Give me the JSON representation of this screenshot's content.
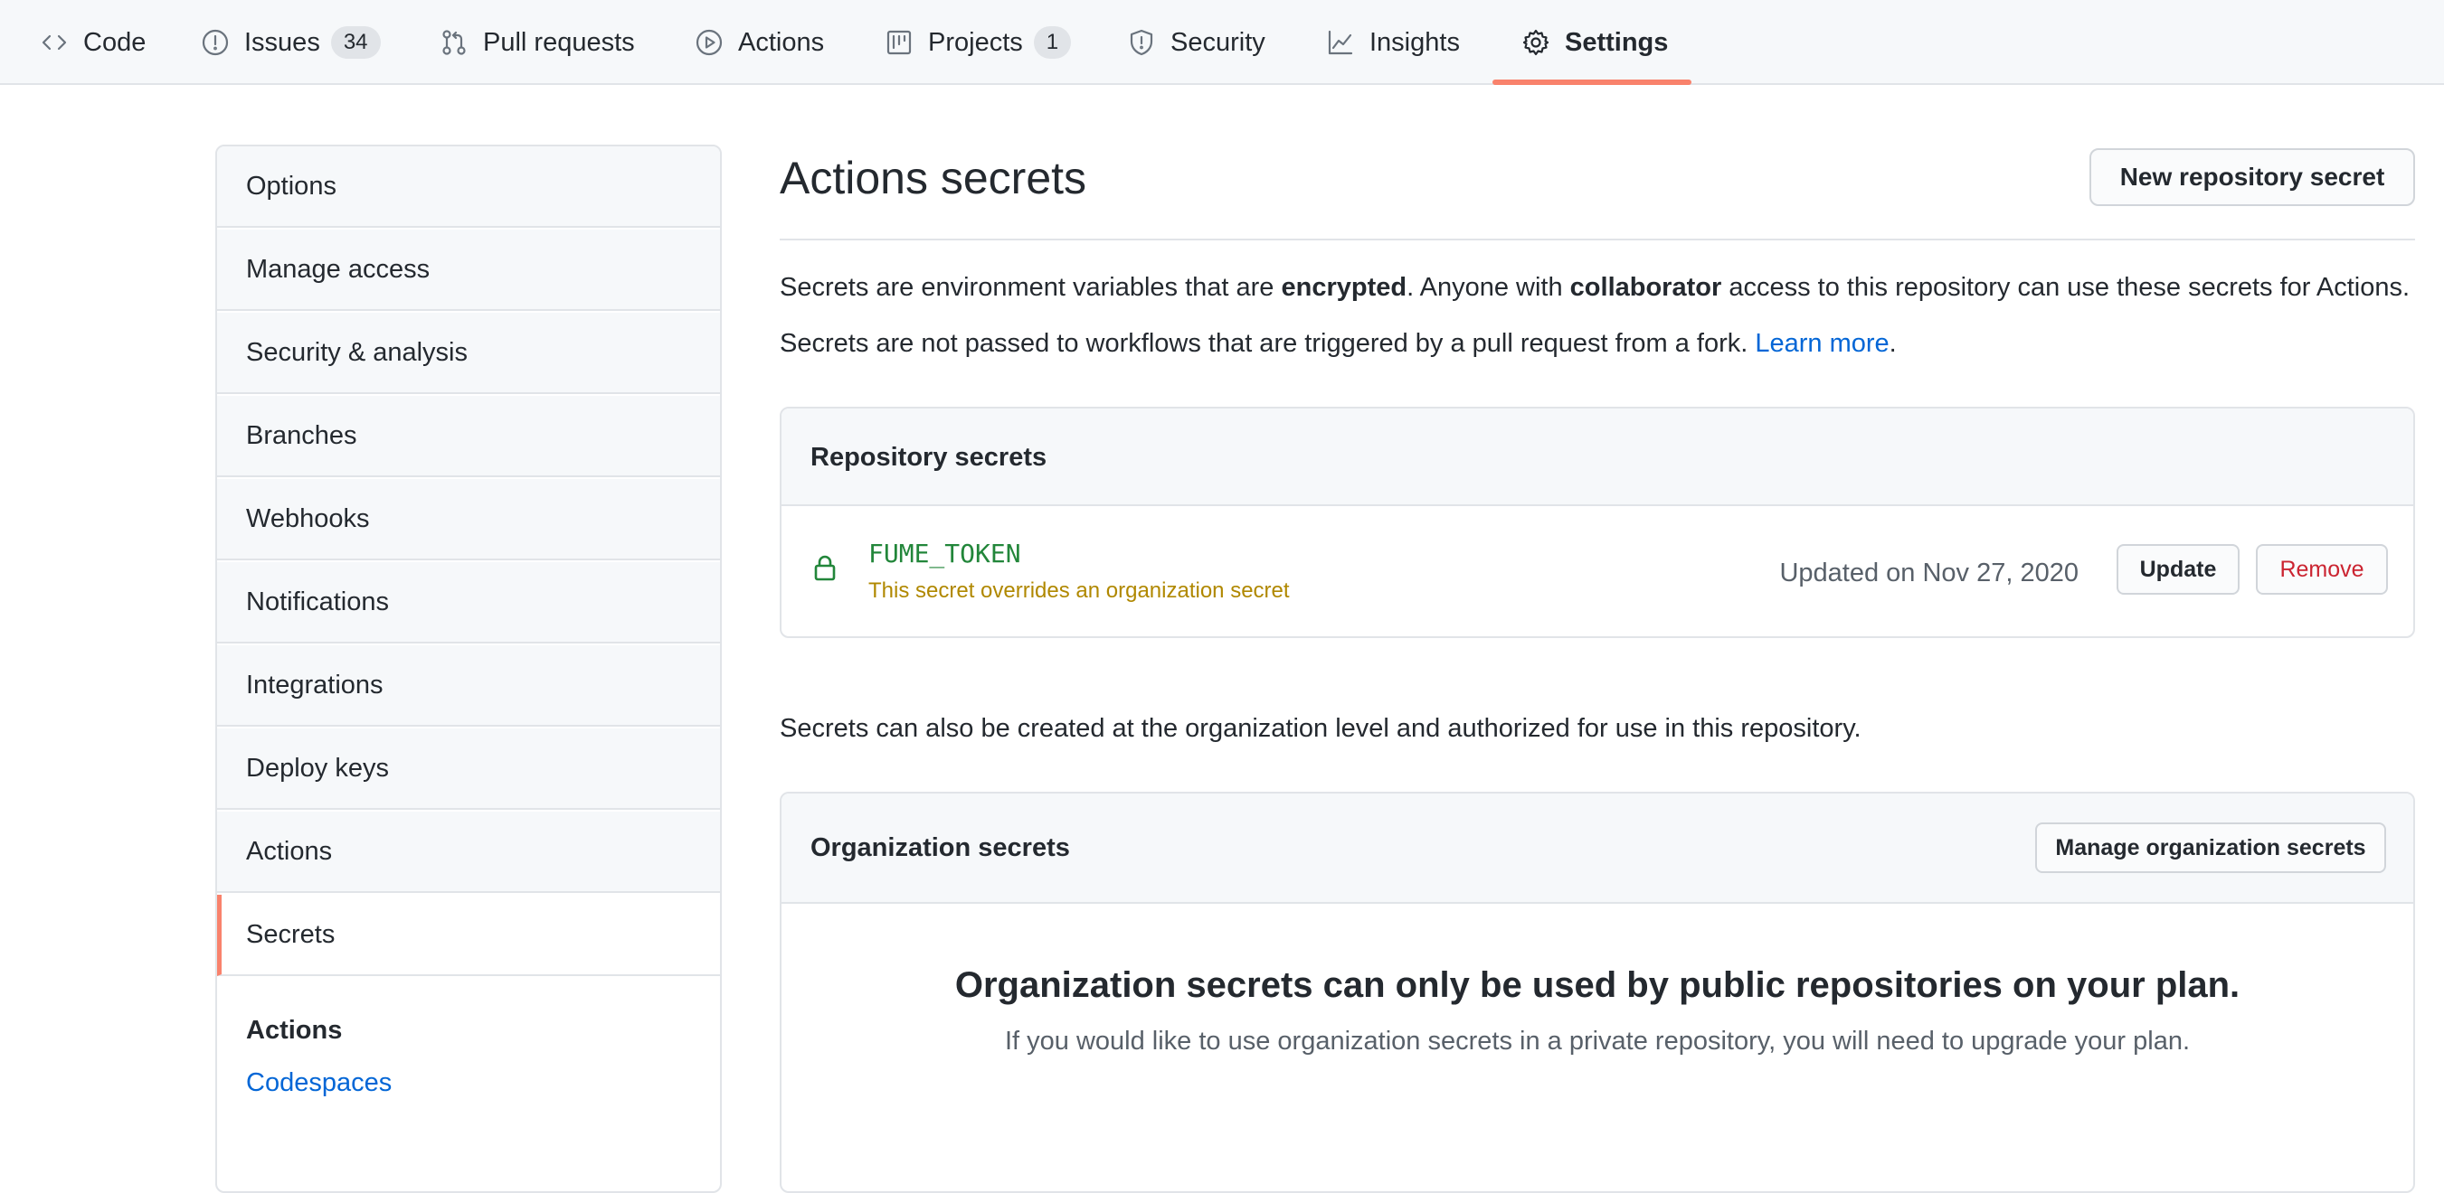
{
  "nav": {
    "tabs": [
      {
        "label": "Code",
        "icon": "code-icon"
      },
      {
        "label": "Issues",
        "icon": "issue-icon",
        "count": "34"
      },
      {
        "label": "Pull requests",
        "icon": "pull-request-icon"
      },
      {
        "label": "Actions",
        "icon": "play-icon"
      },
      {
        "label": "Projects",
        "icon": "project-icon",
        "count": "1"
      },
      {
        "label": "Security",
        "icon": "shield-icon"
      },
      {
        "label": "Insights",
        "icon": "graph-icon"
      },
      {
        "label": "Settings",
        "icon": "gear-icon",
        "selected": true
      }
    ],
    "accent_color": "#f9826c"
  },
  "sidebar": {
    "items": [
      {
        "label": "Options"
      },
      {
        "label": "Manage access"
      },
      {
        "label": "Security & analysis"
      },
      {
        "label": "Branches"
      },
      {
        "label": "Webhooks"
      },
      {
        "label": "Notifications"
      },
      {
        "label": "Integrations"
      },
      {
        "label": "Deploy keys"
      },
      {
        "label": "Actions"
      },
      {
        "label": "Secrets",
        "selected": true
      }
    ],
    "section_heading": "Actions",
    "section_link": "Codespaces"
  },
  "main": {
    "title": "Actions secrets",
    "new_secret_button": "New repository secret",
    "intro_1_a": "Secrets are environment variables that are ",
    "intro_1_b": "encrypted",
    "intro_1_c": ". Anyone with ",
    "intro_1_d": "collaborator",
    "intro_1_e": " access to this repository can use these secrets for Actions.",
    "intro_2_a": "Secrets are not passed to workflows that are triggered by a pull request from a fork. ",
    "intro_2_link": "Learn more",
    "intro_2_b": ".",
    "repo_secrets": {
      "heading": "Repository secrets",
      "secret": {
        "name": "FUME_TOKEN",
        "note": "This secret overrides an organization secret",
        "updated": "Updated on Nov 27, 2020",
        "update_button": "Update",
        "remove_button": "Remove"
      }
    },
    "org_intro": "Secrets can also be created at the organization level and authorized for use in this repository.",
    "org_secrets": {
      "heading": "Organization secrets",
      "manage_button": "Manage organization secrets",
      "blank_title": "Organization secrets can only be used by public repositories on your plan.",
      "blank_sub": "If you would like to use organization secrets in a private repository, you will need to upgrade your plan."
    }
  },
  "colors": {
    "link": "#0366d6",
    "secret_name": "#22863a",
    "warning_text": "#b08800",
    "danger": "#cb2431"
  }
}
